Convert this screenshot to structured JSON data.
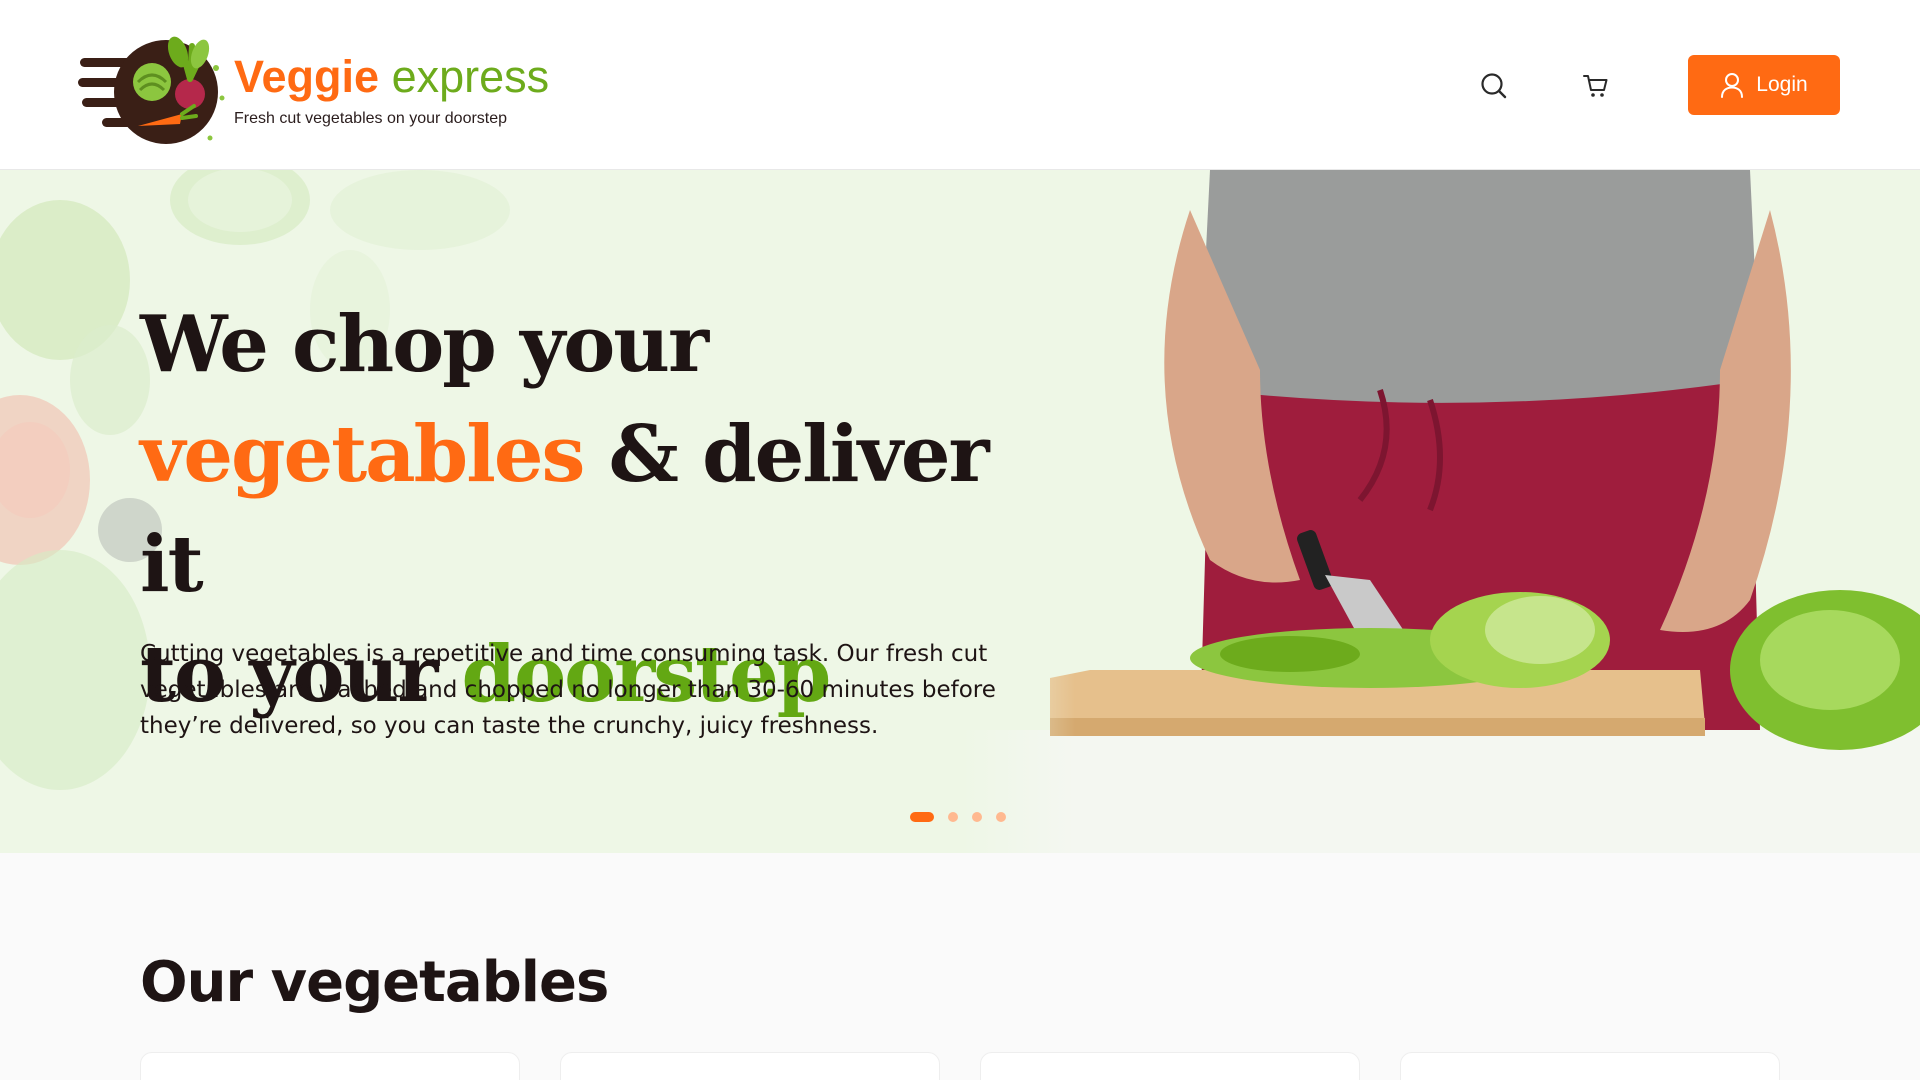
{
  "header": {
    "brand_part1": "Veggie",
    "brand_part2": "express",
    "tagline": "Fresh cut vegetables on your doorstep",
    "login_label": "Login",
    "icons": {
      "search": "search-icon",
      "cart": "cart-icon",
      "user": "user-icon"
    }
  },
  "hero": {
    "headline": {
      "line1": "We chop your",
      "vegetables": "vegetables",
      "deliver": " & deliver it",
      "line3": "to your ",
      "doorstep": "doorstep"
    },
    "description": "Cutting vegetables is a repetitive and time consuming task. Our fresh cut vegetables are washed and chopped no longer than 30-60 minutes before they’re delivered, so you can taste the crunchy, juicy freshness.",
    "slides": {
      "count": 4,
      "active": 1
    }
  },
  "section": {
    "title": "Our vegetables"
  },
  "colors": {
    "accent": "#ff6a13",
    "green": "#63a813",
    "hero_bg": "#eef7e6",
    "text": "#1e1414"
  }
}
